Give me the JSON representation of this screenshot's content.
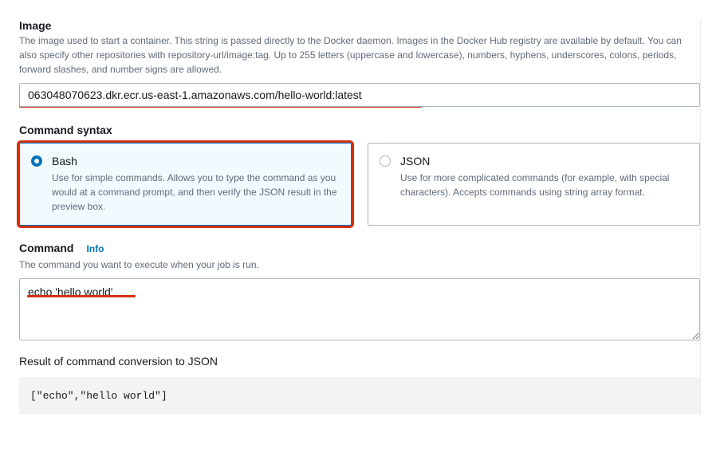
{
  "image": {
    "label": "Image",
    "description": "The image used to start a container. This string is passed directly to the Docker daemon. Images in the Docker Hub registry are available by default. You can also specify other repositories with repository-url/image:tag. Up to 255 letters (uppercase and lowercase), numbers, hyphens, underscores, colons, periods, forward slashes, and number signs are allowed.",
    "value": "063048070623.dkr.ecr.us-east-1.amazonaws.com/hello-world:latest"
  },
  "command_syntax": {
    "label": "Command syntax",
    "options": [
      {
        "title": "Bash",
        "description": "Use for simple commands. Allows you to type the command as you would at a command prompt, and then verify the JSON result in the preview box.",
        "selected": true
      },
      {
        "title": "JSON",
        "description": "Use for more complicated commands (for example, with special characters). Accepts commands using string array format.",
        "selected": false
      }
    ]
  },
  "command": {
    "label": "Command",
    "info_label": "Info",
    "description": "The command you want to execute when your job is run.",
    "value": "echo 'hello world'"
  },
  "result": {
    "label": "Result of command conversion to JSON",
    "value": "[\"echo\",\"hello world\"]"
  }
}
